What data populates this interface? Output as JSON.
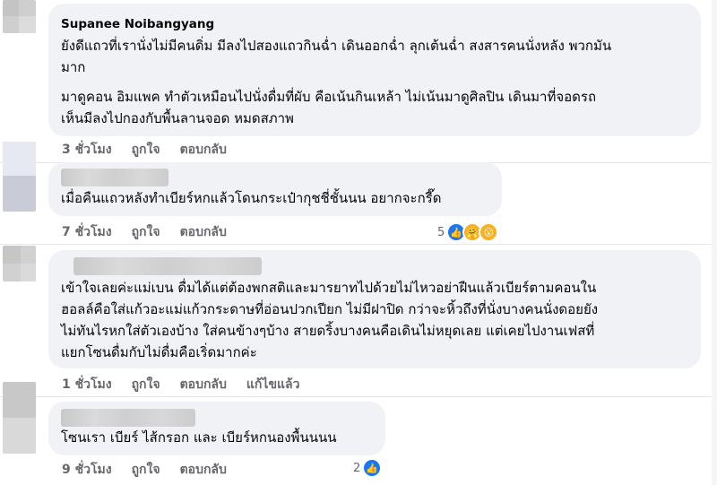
{
  "comments": [
    {
      "author": "Supanee Noibangyang",
      "author_visible": true,
      "paragraphs": [
        [
          "ยังดีแถวที่เรานั่งไม่มีคนดิ่ม มีลงไปสองแถวกินฉ่ำ เดินออกฉ่ำ ลุกเต้นฉ่ำ สงสารคนนั่งหลัง พวกมัน",
          "มาก"
        ],
        [
          "มาดูคอน อิมแพค ทำตัวเหมือนไปนั่งดื่มที่ผับ คือเน้นกินเหล้า ไม่เน้นมาดูศิลปิน เดินมาที่จอดรถ",
          "เห็นมีลงไปกองกับพื้นลานจอด หมดสภาพ"
        ]
      ],
      "time": "3 ชั่วโมง",
      "like": "ถูกใจ",
      "reply": "ตอบกลับ"
    },
    {
      "author": "",
      "author_visible": false,
      "paragraphs": [
        [
          "เมื่อคืนแถวหลังทำเบียร์หกแล้วโดนกระเป๋ากุชชี่ชั้นนน อยากจะกรี๊ด"
        ]
      ],
      "time": "7 ชั่วโมง",
      "like": "ถูกใจ",
      "reply": "ตอบกลับ",
      "reaction_count": "5",
      "reaction_icons": [
        "like-icon",
        "care-icon",
        "wow-icon"
      ]
    },
    {
      "author": "",
      "author_visible": false,
      "paragraphs": [
        [
          "เข้าใจเลยค่ะแม่เบน ดื่มได้แต่ต้องพกสติและมารยาทไปด้วยไม่ไหวอย่าฝืนแล้วเบียร์ตามคอนใน",
          "ฮอลล์คือใส่แก้วอะแม่แก้วกระดาษที่อ่อนปวกเปียก ไม่มีฝาปิด กว่าจะหิ้วถึงที่นั่งบางคนนั่งดอยยัง",
          "ไม่ทันไรหกใส่ตัวเองบ้าง ใส่คนข้างๆบ้าง สายดริ้งบางคนคือเดินไม่หยุดเลย แต่เคยไปงานเฟสที่",
          "แยกโซนดื่มกับไม่ดื่มคือเริ่ดมากค่ะ"
        ]
      ],
      "time": "1 ชั่วโมง",
      "like": "ถูกใจ",
      "reply": "ตอบกลับ",
      "edited": "แก้ไขแล้ว"
    },
    {
      "author": "",
      "author_visible": false,
      "paragraphs": [
        [
          "โซนเรา เบียร์ ไส้กรอก และ เบียร์หกนองพื้นนนน"
        ]
      ],
      "time": "9 ชั่วโมง",
      "like": "ถูกใจ",
      "reply": "ตอบกลับ",
      "reaction_count": "2",
      "reaction_icons": [
        "like-icon"
      ]
    }
  ],
  "colors": {
    "bubble": "#f0f2f5",
    "meta_text": "#65676b",
    "like_blue": "#1877f2",
    "emoji_yellow": "#f7b125"
  }
}
